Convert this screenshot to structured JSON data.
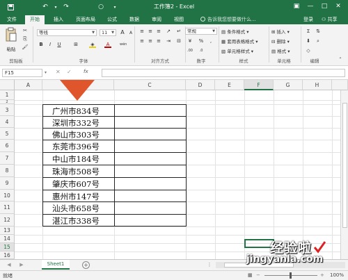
{
  "titlebar": {
    "title": "工作簿2 - Excel"
  },
  "tabs": [
    {
      "label": "文件"
    },
    {
      "label": "开始"
    },
    {
      "label": "插入"
    },
    {
      "label": "页面布局"
    },
    {
      "label": "公式"
    },
    {
      "label": "数据"
    },
    {
      "label": "审阅"
    },
    {
      "label": "视图"
    }
  ],
  "tell_me": "告诉我您想要做什么...",
  "account": {
    "login": "登录",
    "share": "共享"
  },
  "ribbon": {
    "clipboard": {
      "label": "剪贴板",
      "paste": "粘贴"
    },
    "font": {
      "name": "等线",
      "size": "11",
      "label": "字体"
    },
    "alignment": {
      "label": "对齐方式"
    },
    "number": {
      "format": "常规",
      "label": "数字"
    },
    "styles": {
      "conditional": "条件格式",
      "table": "套用表格格式",
      "cell": "单元格样式",
      "label": "样式"
    },
    "cells": {
      "insert": "插入",
      "delete": "删除",
      "format": "格式",
      "label": "单元格"
    },
    "editing": {
      "label": "编辑"
    }
  },
  "formula_bar": {
    "name_box": "F15",
    "fx": "fx",
    "value": ""
  },
  "columns": [
    "A",
    "B",
    "C",
    "D",
    "E",
    "F",
    "G",
    "H"
  ],
  "selected_column": "F",
  "rows": [
    "1",
    "2",
    "3",
    "4",
    "5",
    "6",
    "7",
    "8",
    "9",
    "10",
    "11",
    "12",
    "13",
    "14",
    "15",
    "16"
  ],
  "selected_row": "15",
  "cells_b": [
    "广州市834号",
    "深圳市332号",
    "佛山市303号",
    "东莞市396号",
    "中山市184号",
    "珠海市508号",
    "肇庆市607号",
    "惠州市147号",
    "汕头市658号",
    "湛江市338号"
  ],
  "sheet_tab": "Sheet1",
  "status": {
    "ready": "就绪",
    "zoom": "100%"
  },
  "watermark": {
    "cn": "经验啦",
    "en": "jingyanla.com"
  },
  "colors": {
    "accent": "#217346",
    "arrow": "#e0562c"
  }
}
